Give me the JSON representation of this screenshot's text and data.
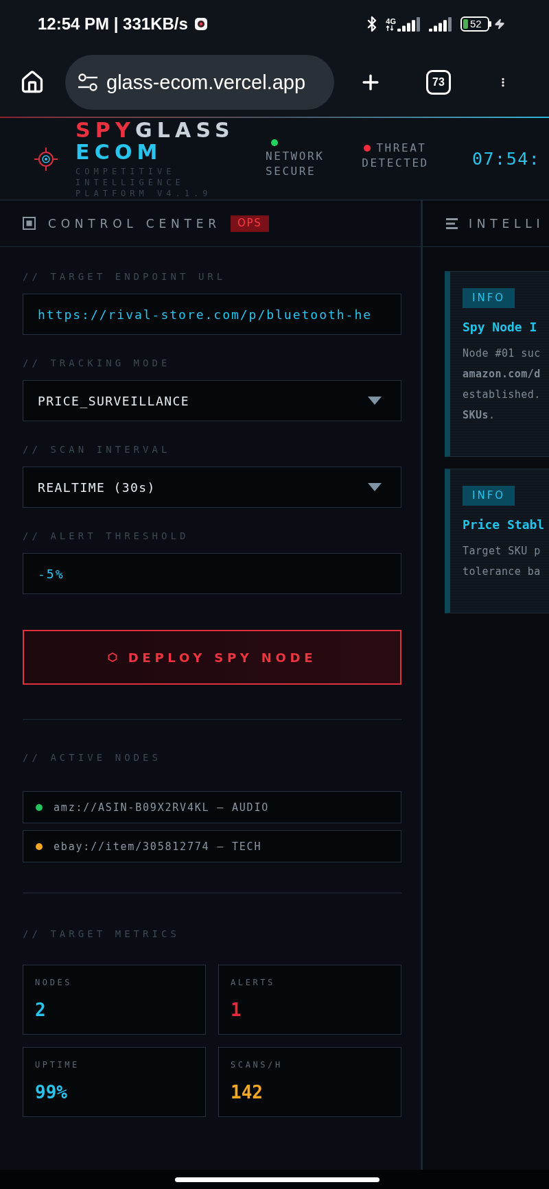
{
  "status_bar": {
    "time": "12:54 PM | 331KB/s",
    "network_type": "4G",
    "battery": "52"
  },
  "browser": {
    "url": "glass-ecom.vercel.app",
    "tab_count": "73"
  },
  "header": {
    "logo": {
      "accent": "SPY",
      "rest": "GLASS",
      "second_line": "ECOM"
    },
    "tagline": "COMPETITIVE INTELLIGENCE PLATFORM V4.1.9",
    "statuses": [
      {
        "kind": "stacked",
        "label": "NETWORK SECURE",
        "color": "#22d35e"
      },
      {
        "kind": "inline",
        "label": "THREAT DETECTED",
        "color": "#ef2b3c"
      }
    ],
    "clock": "07:54:"
  },
  "control_center": {
    "title": "CONTROL CENTER",
    "badge": "OPS",
    "fields": [
      {
        "kind": "input",
        "label": "// TARGET ENDPOINT URL",
        "value": "https://rival-store.com/p/bluetooth-he"
      },
      {
        "kind": "select",
        "label": "// TRACKING MODE",
        "value": "PRICE_SURVEILLANCE"
      },
      {
        "kind": "select",
        "label": "// SCAN INTERVAL",
        "value": "REALTIME (30s)"
      },
      {
        "kind": "input",
        "label": "// ALERT THRESHOLD",
        "value": "-5%"
      }
    ],
    "deploy_button": "DEPLOY SPY NODE",
    "active_nodes": {
      "label": "// ACTIVE NODES",
      "items": [
        {
          "text": "amz://ASIN-B09X2RV4KL — AUDIO",
          "color": "#22c55e"
        },
        {
          "text": "ebay://item/305812774 — TECH",
          "color": "#f5a623"
        }
      ]
    },
    "metrics": {
      "label": "// TARGET METRICS",
      "items": [
        {
          "label": "NODES",
          "value": "2",
          "color": "#29c4ee"
        },
        {
          "label": "ALERTS",
          "value": "1",
          "color": "#e8283c"
        },
        {
          "label": "UPTIME",
          "value": "99%",
          "color": "#29c4ee"
        },
        {
          "label": "SCANS/H",
          "value": "142",
          "color": "#f5a623"
        }
      ]
    }
  },
  "intelligence": {
    "title": "INTELLI",
    "cards": [
      {
        "badge": "INFO",
        "title": "Spy Node I",
        "body": [
          "Node #01 suc",
          "**amazon.com/d**",
          "established.",
          "**SKUs**."
        ]
      },
      {
        "badge": "INFO",
        "title": "Price Stabl",
        "body": [
          "Target SKU p",
          "tolerance ba"
        ]
      }
    ]
  }
}
